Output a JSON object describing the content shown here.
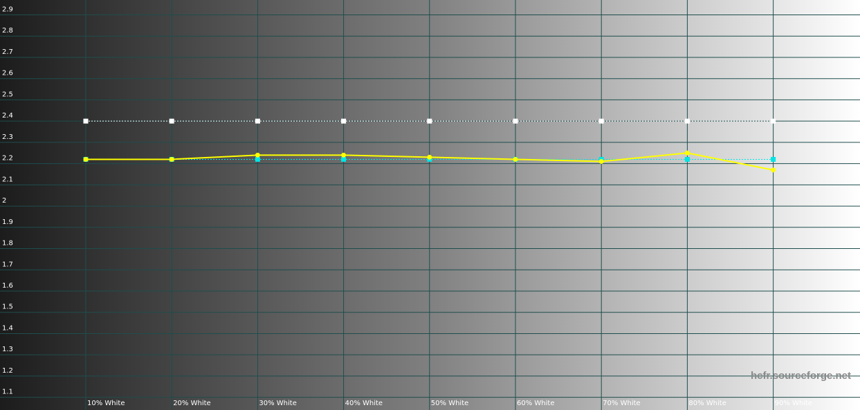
{
  "chart_data": {
    "type": "line",
    "categories": [
      "10% White",
      "20% White",
      "30% White",
      "40% White",
      "50% White",
      "60% White",
      "70% White",
      "80% White",
      "90% White"
    ],
    "y_ticks": [
      "2.9",
      "2.8",
      "2.7",
      "2.6",
      "2.5",
      "2.4",
      "2.3",
      "2.2",
      "2.1",
      "2",
      "1.9",
      "1.8",
      "1.7",
      "1.6",
      "1.5",
      "1.4",
      "1.3",
      "1.2",
      "1.1"
    ],
    "ylim": [
      1.05,
      2.97
    ],
    "grid": true,
    "series": [
      {
        "key": "reference",
        "color": "#ffffff",
        "style": "dotted",
        "values": [
          2.4,
          2.4,
          2.4,
          2.4,
          2.4,
          2.4,
          2.4,
          2.4,
          2.4
        ]
      },
      {
        "key": "target",
        "color": "#00e5e5",
        "style": "dotted",
        "values": [
          2.22,
          2.22,
          2.22,
          2.22,
          2.22,
          2.22,
          2.22,
          2.22,
          2.22
        ]
      },
      {
        "key": "measured",
        "color": "#ffff00",
        "style": "solid",
        "values": [
          2.22,
          2.22,
          2.24,
          2.24,
          2.23,
          2.22,
          2.21,
          2.25,
          2.17
        ]
      }
    ],
    "watermark": "hcfr.sourceforge.net"
  }
}
